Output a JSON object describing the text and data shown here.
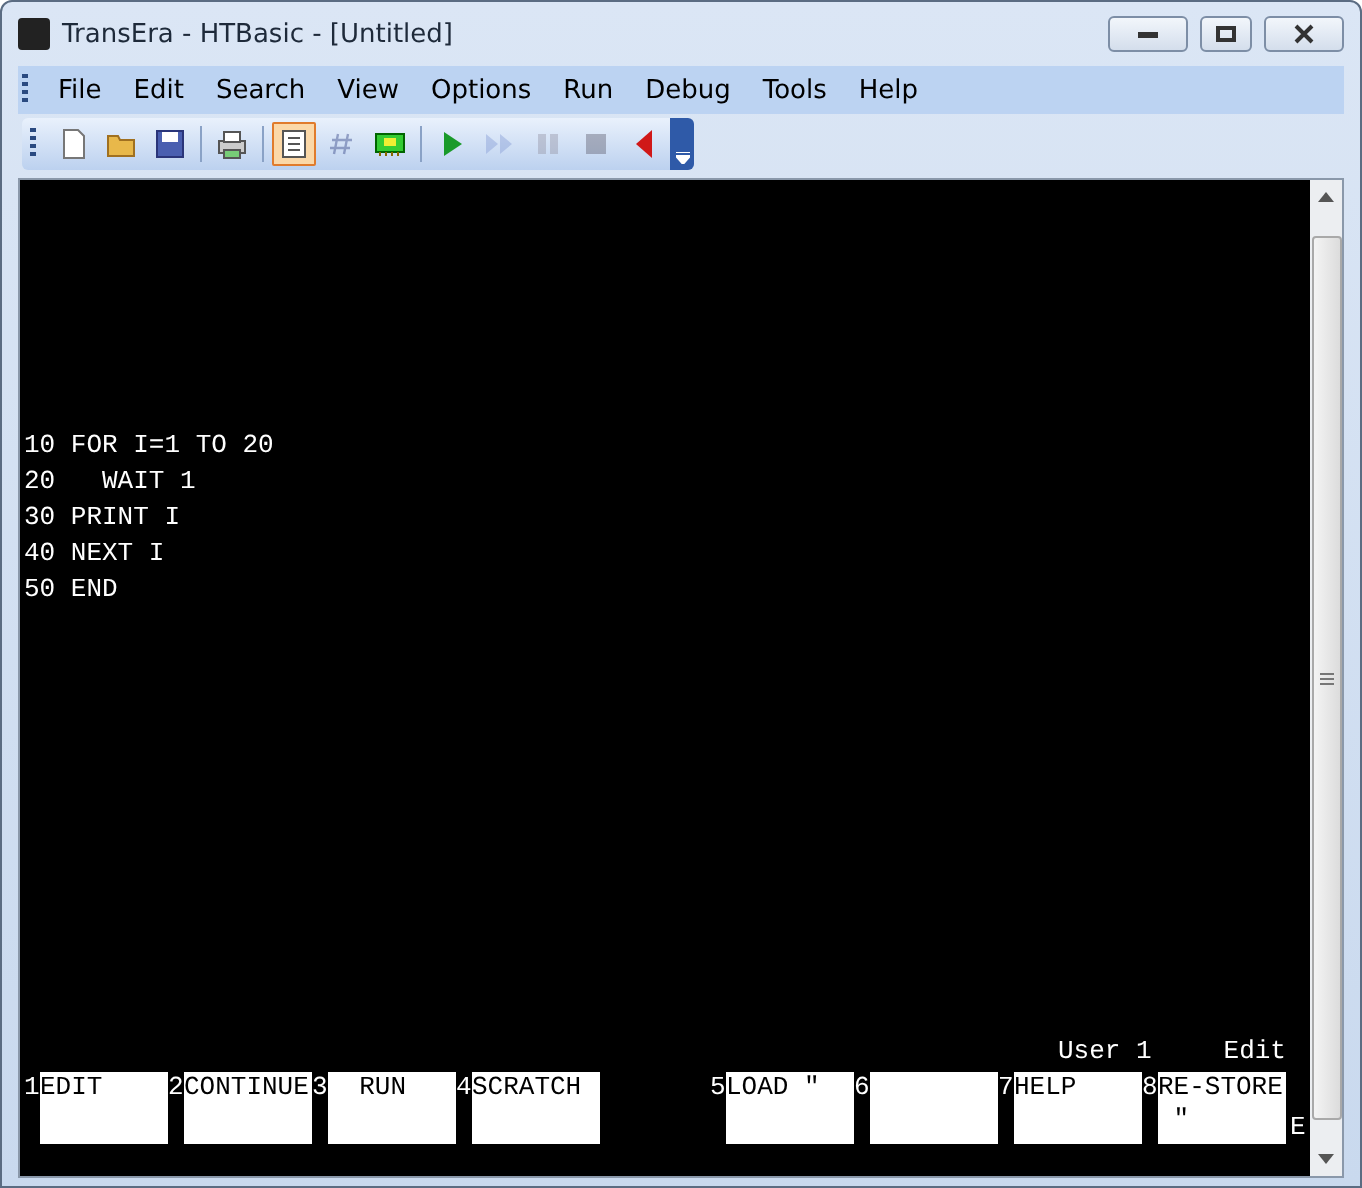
{
  "window": {
    "title": "TransEra - HTBasic - [Untitled]"
  },
  "menu": [
    {
      "label": "File"
    },
    {
      "label": "Edit"
    },
    {
      "label": "Search"
    },
    {
      "label": "View"
    },
    {
      "label": "Options"
    },
    {
      "label": "Run"
    },
    {
      "label": "Debug"
    },
    {
      "label": "Tools"
    },
    {
      "label": "Help"
    }
  ],
  "toolbar": [
    {
      "kind": "new",
      "selected": false,
      "disabled": false
    },
    {
      "kind": "open",
      "selected": false,
      "disabled": false
    },
    {
      "kind": "save",
      "selected": false,
      "disabled": false
    },
    {
      "kind": "print",
      "selected": false,
      "disabled": false
    },
    {
      "kind": "edit",
      "selected": true,
      "disabled": false
    },
    {
      "kind": "hash",
      "selected": false,
      "disabled": true
    },
    {
      "kind": "card",
      "selected": false,
      "disabled": false
    },
    {
      "kind": "run",
      "selected": false,
      "disabled": false
    },
    {
      "kind": "continue",
      "selected": false,
      "disabled": true
    },
    {
      "kind": "pause",
      "selected": false,
      "disabled": true
    },
    {
      "kind": "stop",
      "selected": false,
      "disabled": true
    },
    {
      "kind": "back",
      "selected": false,
      "disabled": false
    }
  ],
  "program_lines": [
    "10 FOR I=1 TO 20",
    "20   WAIT 1",
    "30 PRINT I",
    "40 NEXT I",
    "50 END"
  ],
  "status": {
    "user": "User 1",
    "mode": "Edit"
  },
  "softkeys": [
    {
      "number": "1",
      "label": "EDIT"
    },
    {
      "number": "2",
      "label": "CONTINUE"
    },
    {
      "number": "3",
      "label": "  RUN"
    },
    {
      "number": "4",
      "label": "SCRATCH"
    },
    {
      "number": "5",
      "label": "LOAD ″"
    },
    {
      "number": "6"
    },
    {
      "number": "7",
      "label": "HELP"
    },
    {
      "number": "8",
      "label": "RE-STORE",
      "label_2": " ″"
    }
  ],
  "indicator": "E"
}
